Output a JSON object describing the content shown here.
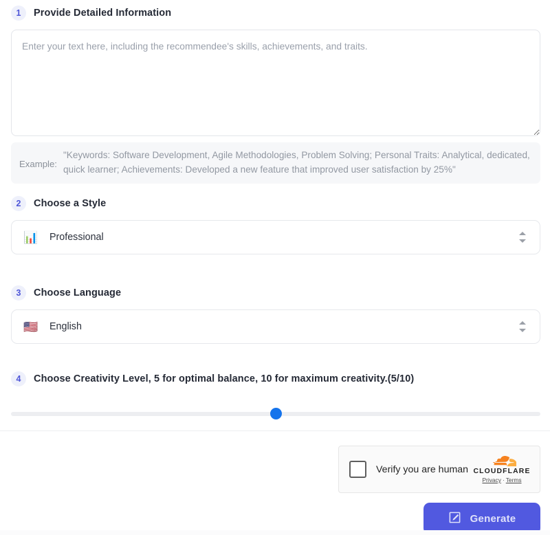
{
  "steps": [
    {
      "number": "1",
      "title": "Provide Detailed Information"
    },
    {
      "number": "2",
      "title": "Choose a Style"
    },
    {
      "number": "3",
      "title": "Choose Language"
    },
    {
      "number": "4",
      "title": "Choose Creativity Level, 5 for optimal balance, 10 for maximum creativity.(5/10)"
    }
  ],
  "details": {
    "textarea_placeholder": "Enter your text here, including the recommendee's skills, achievements, and traits.",
    "textarea_value": "",
    "example_label": "Example:",
    "example_text": "\"Keywords: Software Development, Agile Methodologies, Problem Solving; Personal Traits: Analytical, dedicated, quick learner; Achievements: Developed a new feature that improved user satisfaction by 25%\""
  },
  "style_select": {
    "icon": "bar-chart-emoji",
    "emoji": "📊",
    "value": "Professional"
  },
  "language_select": {
    "icon": "us-flag-emoji",
    "emoji": "🇺🇸",
    "value": "English"
  },
  "creativity": {
    "value": "5",
    "max": "10",
    "display": "(5/10)",
    "thumb_color": "#1574ec",
    "track_color": "#edeef1"
  },
  "turnstile": {
    "checkbox_label": "Verify you are human",
    "brand": "CLOUDFLARE",
    "privacy_label": "Privacy",
    "separator": "·",
    "terms_label": "Terms",
    "logo_color": "#f6821f"
  },
  "generate_button": {
    "label": "Generate",
    "icon": "edit-square-icon",
    "bg_color": "#5159e0",
    "text_color": "#dfe1fa"
  },
  "theme": {
    "badge_bg": "#eef0fb",
    "badge_text": "#4f56d8",
    "border": "#e6e8ec",
    "example_bg": "#f6f7f9"
  }
}
